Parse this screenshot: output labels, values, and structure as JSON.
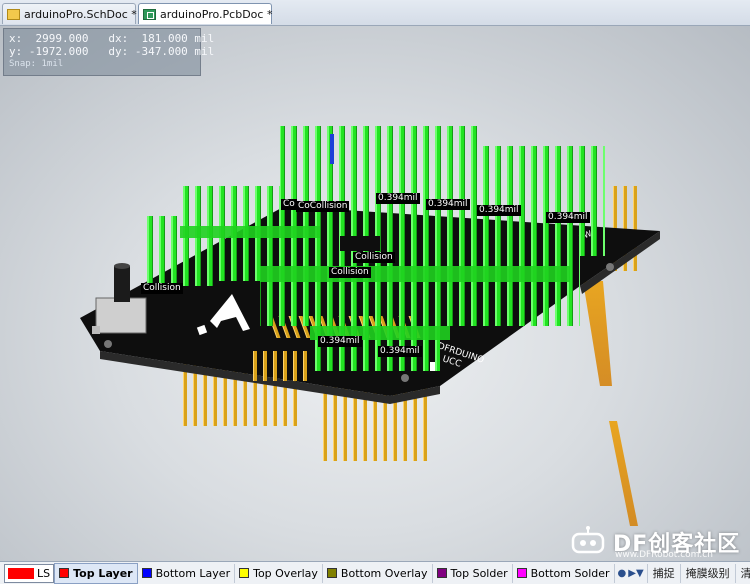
{
  "tabs": [
    {
      "label": "arduinoPro.SchDoc *",
      "icon": "schematic-doc-icon"
    },
    {
      "label": "arduinoPro.PcbDoc *",
      "icon": "pcb-doc-icon",
      "active": true
    }
  ],
  "readout": {
    "line1": "x:  2999.000   dx:  181.000 mil",
    "line2": "y: -1972.000   dy: -347.000 mil",
    "snap": "Snap: 1mil"
  },
  "labels": {
    "collision": [
      "Co",
      "CoCollision",
      "Collision",
      "Collision",
      "Collision"
    ],
    "clearance": [
      "0.394mil",
      "0.394mil",
      "0.394mil",
      "0.394mil",
      "0.394mil",
      "0.394mil"
    ]
  },
  "watermark": {
    "brand": "DF创客社区",
    "url": "www.DFRobot.com.cn"
  },
  "status": {
    "ls": "LS",
    "ls_color": "#ff0000",
    "layers": [
      {
        "label": "Top Layer",
        "color": "#ff0000",
        "active": true
      },
      {
        "label": "Bottom Layer",
        "color": "#0000ff"
      },
      {
        "label": "Top Overlay",
        "color": "#ffff00"
      },
      {
        "label": "Bottom Overlay",
        "color": "#808000"
      },
      {
        "label": "Top Solder",
        "color": "#800080"
      },
      {
        "label": "Bottom Solder",
        "color": "#ff00ff"
      }
    ],
    "buttons": [
      "捕捉",
      "掩膜级别",
      "清除"
    ]
  },
  "colors": {
    "collision_green": "#22e322",
    "board": "#111111",
    "pin_gold": "#d9a21a"
  }
}
